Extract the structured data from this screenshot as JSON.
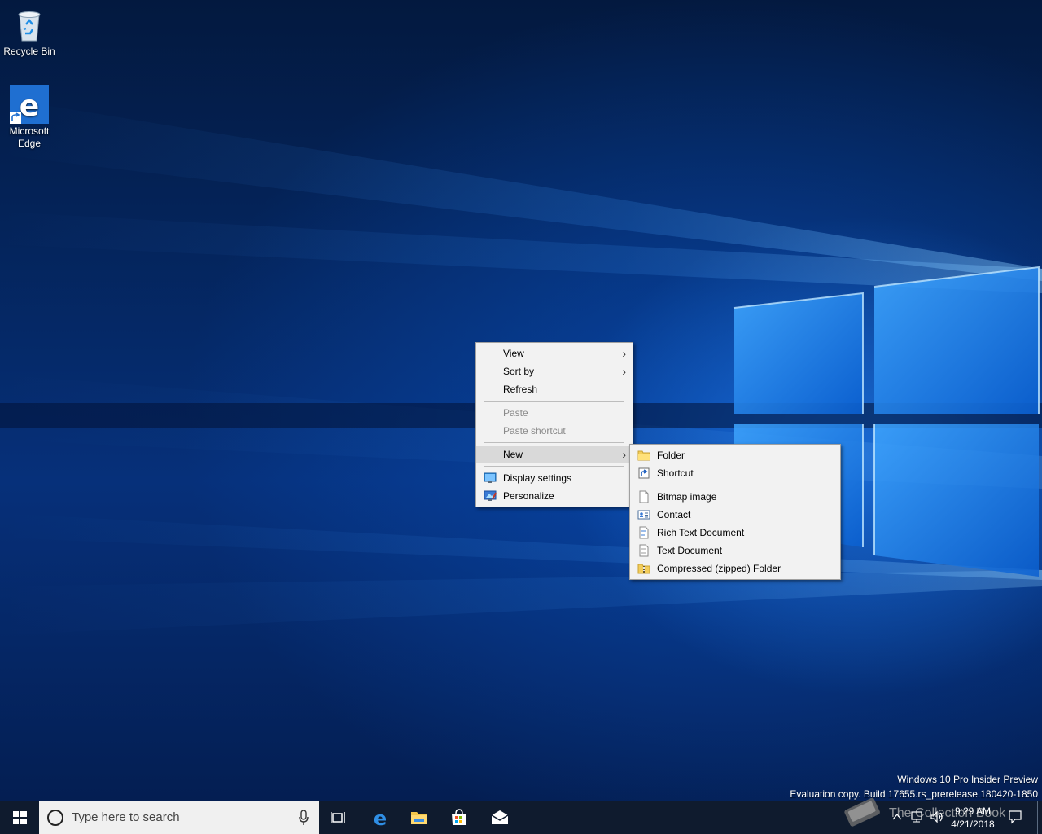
{
  "desktop": {
    "icons": [
      {
        "label": "Recycle Bin"
      },
      {
        "label_line1": "Microsoft",
        "label_line2": "Edge"
      }
    ],
    "watermark": {
      "line1": "Windows 10 Pro Insider Preview",
      "line2": "Evaluation copy. Build 17655.rs_prerelease.180420-1850"
    }
  },
  "context_menu": {
    "items": [
      {
        "label": "View",
        "submenu": true
      },
      {
        "label": "Sort by",
        "submenu": true
      },
      {
        "label": "Refresh"
      },
      {
        "label": "Paste",
        "disabled": true
      },
      {
        "label": "Paste shortcut",
        "disabled": true
      },
      {
        "label": "New",
        "submenu": true,
        "active": true
      },
      {
        "label": "Display settings",
        "icon": "display-icon"
      },
      {
        "label": "Personalize",
        "icon": "personalize-icon"
      }
    ],
    "arrow": "›"
  },
  "new_submenu": {
    "items": [
      {
        "label": "Folder",
        "icon": "folder-icon"
      },
      {
        "label": "Shortcut",
        "icon": "shortcut-icon"
      },
      {
        "label": "Bitmap image",
        "icon": "bitmap-icon"
      },
      {
        "label": "Contact",
        "icon": "contact-icon"
      },
      {
        "label": "Rich Text Document",
        "icon": "rtf-icon"
      },
      {
        "label": "Text Document",
        "icon": "text-document-icon"
      },
      {
        "label": "Compressed (zipped) Folder",
        "icon": "zip-folder-icon"
      }
    ]
  },
  "taskbar": {
    "search_placeholder": "Type here to search",
    "pinned": [
      "task-view-icon",
      "edge-icon",
      "file-explorer-icon",
      "store-icon",
      "mail-icon"
    ],
    "clock": {
      "time": "9:29 AM",
      "date": "4/21/2018"
    },
    "overlay_text": "The Collection Book"
  },
  "colors": {
    "accent": "#0078d7",
    "menu_bg": "#f2f2f2",
    "taskbar_bg": "#0f1b2e"
  }
}
